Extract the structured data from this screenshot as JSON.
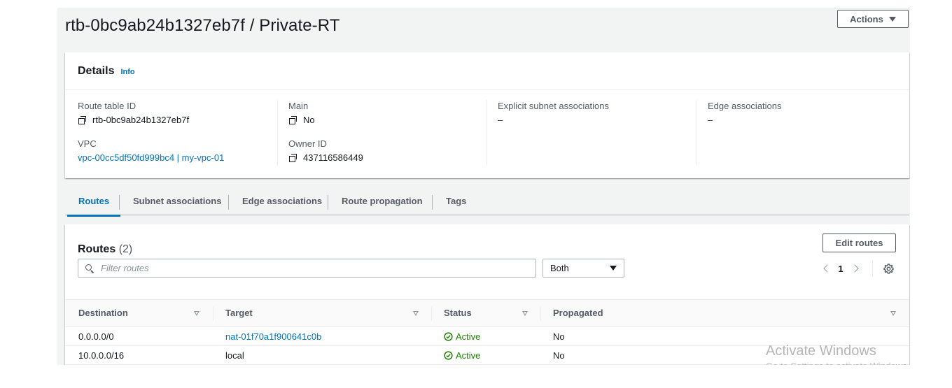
{
  "header": {
    "title": "rtb-0bc9ab24b1327eb7f / Private-RT",
    "actions_label": "Actions"
  },
  "details": {
    "title": "Details",
    "info_label": "Info",
    "route_table_id_label": "Route table ID",
    "route_table_id_value": "rtb-0bc9ab24b1327eb7f",
    "vpc_label": "VPC",
    "vpc_value": "vpc-00cc5df50fd999bc4 | my-vpc-01",
    "main_label": "Main",
    "main_value": "No",
    "owner_id_label": "Owner ID",
    "owner_id_value": "437116586449",
    "explicit_subnet_label": "Explicit subnet associations",
    "explicit_subnet_value": "–",
    "edge_associations_label": "Edge associations",
    "edge_associations_value": "–"
  },
  "tabs": [
    {
      "label": "Routes",
      "active": true
    },
    {
      "label": "Subnet associations",
      "active": false
    },
    {
      "label": "Edge associations",
      "active": false
    },
    {
      "label": "Route propagation",
      "active": false
    },
    {
      "label": "Tags",
      "active": false
    }
  ],
  "routes": {
    "title": "Routes",
    "count": "(2)",
    "edit_label": "Edit routes",
    "filter_placeholder": "Filter routes",
    "filter_value": "",
    "select_value": "Both",
    "page_number": "1",
    "columns": [
      "Destination",
      "Target",
      "Status",
      "Propagated"
    ],
    "rows": [
      {
        "destination": "0.0.0.0/0",
        "target": "nat-01f70a1f900641c0b",
        "status": "Active",
        "propagated": "No"
      },
      {
        "destination": "10.0.0.0/16",
        "target": "local",
        "status": "Active",
        "propagated": "No"
      }
    ]
  },
  "watermark": {
    "line1": "Activate Windows",
    "line2": "Go to Settings to activate Windows."
  },
  "colors": {
    "link": "#0073bb",
    "active_status": "#1d8102",
    "page_background": "#f2f3f3"
  },
  "icons": [
    "copy-icon",
    "search-icon",
    "caret-down-icon",
    "chevron-left-icon",
    "chevron-right-icon",
    "gear-icon",
    "sort-icon",
    "check-circle-icon"
  ]
}
